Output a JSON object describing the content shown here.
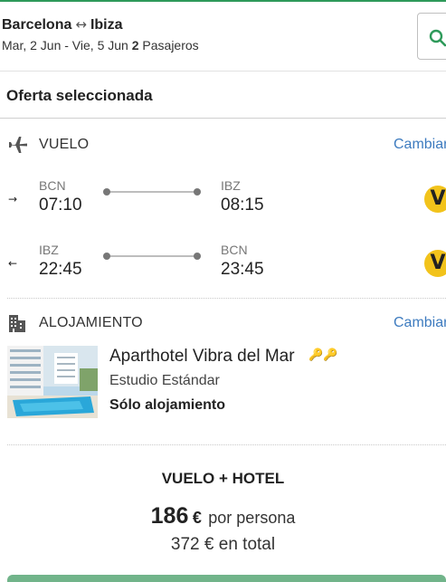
{
  "header": {
    "origin": "Barcelona",
    "route_arrow": "↔",
    "destination": "Ibiza",
    "dates": "Mar, 2 Jun - Vie, 5 Jun",
    "passengers_count": "2",
    "passengers_label": "Pasajeros",
    "search_icon": "search-icon"
  },
  "offer": {
    "title": "Oferta seleccionada"
  },
  "flight": {
    "section_label": "VUELO",
    "change_label": "Cambiar",
    "icon": "airplane-icon",
    "legs": [
      {
        "direction_icon": "→",
        "from_code": "BCN",
        "from_time": "07:10",
        "to_code": "IBZ",
        "to_time": "08:15",
        "airline_logo": "V"
      },
      {
        "direction_icon": "←",
        "from_code": "IBZ",
        "from_time": "22:45",
        "to_code": "BCN",
        "to_time": "23:45",
        "airline_logo": "V"
      }
    ]
  },
  "accommodation": {
    "section_label": "ALOJAMIENTO",
    "change_label": "Cambiar",
    "icon": "building-icon",
    "hotel_name": "Aparthotel Vibra del Mar",
    "rating_icons": "🔑🔑",
    "room_type": "Estudio Estándar",
    "board": "Sólo alojamiento"
  },
  "price": {
    "package_label": "VUELO + HOTEL",
    "per_person_amount": "186",
    "currency": "€",
    "per_person_label": "por persona",
    "total_text": "372 € en total"
  },
  "colors": {
    "accent_link": "#3d7bbf",
    "cta_green": "#71b48a",
    "airline_yellow": "#f2c31b",
    "top_line": "#2e9a5a"
  }
}
